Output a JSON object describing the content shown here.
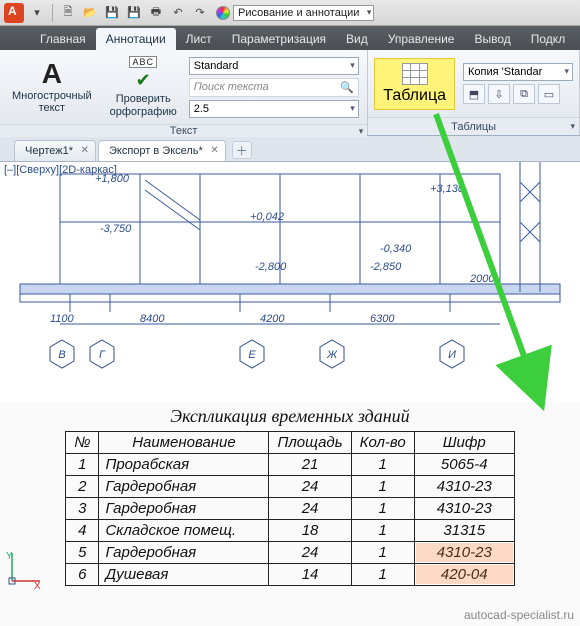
{
  "qat": {
    "workspace_label": "Рисование и аннотации"
  },
  "ribbon": {
    "tabs": [
      "Главная",
      "Аннотации",
      "Лист",
      "Параметризация",
      "Вид",
      "Управление",
      "Вывод",
      "Подкл"
    ],
    "active_tab": 1,
    "panel_text": {
      "mtext": "Многострочный\nтекст",
      "spell": "Проверить\nорфографию",
      "abc": "ABC",
      "style_dd": "Standard",
      "search_ph": "Поиск текста",
      "height_dd": "2.5",
      "panel_text_title": "Текст",
      "table_btn": "Таблица",
      "copy_dd": "Копия 'Standar",
      "panel_tables_title": "Таблицы"
    }
  },
  "doc_tabs": {
    "tabs": [
      "Чертеж1*",
      "Экспорт в Эксель*"
    ],
    "active": 1
  },
  "view": {
    "label": "[–][Сверху][2D-каркас]"
  },
  "drawing": {
    "elev_labels": [
      "+3,130",
      "+0,042",
      "-0,340",
      "-2,800",
      "-2,850",
      "-3,750",
      "2000"
    ],
    "dims_bottom": [
      "1100",
      "8400",
      "4200",
      "6300"
    ],
    "left_dim": "+1,800",
    "axes": [
      "В",
      "Г",
      "Е",
      "Ж",
      "И"
    ]
  },
  "table": {
    "title": "Экспликация временных зданий",
    "headers": [
      "№",
      "Наименование",
      "Площадь",
      "Кол-во",
      "Шифр"
    ],
    "rows": [
      {
        "n": "1",
        "name": "Прорабская",
        "area": "21",
        "qty": "1",
        "code": "5065-4"
      },
      {
        "n": "2",
        "name": "Гардеробная",
        "area": "24",
        "qty": "1",
        "code": "4310-23"
      },
      {
        "n": "3",
        "name": "Гардеробная",
        "area": "24",
        "qty": "1",
        "code": "4310-23"
      },
      {
        "n": "4",
        "name": "Складское помещ.",
        "area": "18",
        "qty": "1",
        "code": "31315"
      },
      {
        "n": "5",
        "name": "Гардеробная",
        "area": "24",
        "qty": "1",
        "code": "4310-23"
      },
      {
        "n": "6",
        "name": "Душевая",
        "area": "14",
        "qty": "1",
        "code": "420-04"
      }
    ]
  },
  "watermark": "autocad-specialist.ru"
}
